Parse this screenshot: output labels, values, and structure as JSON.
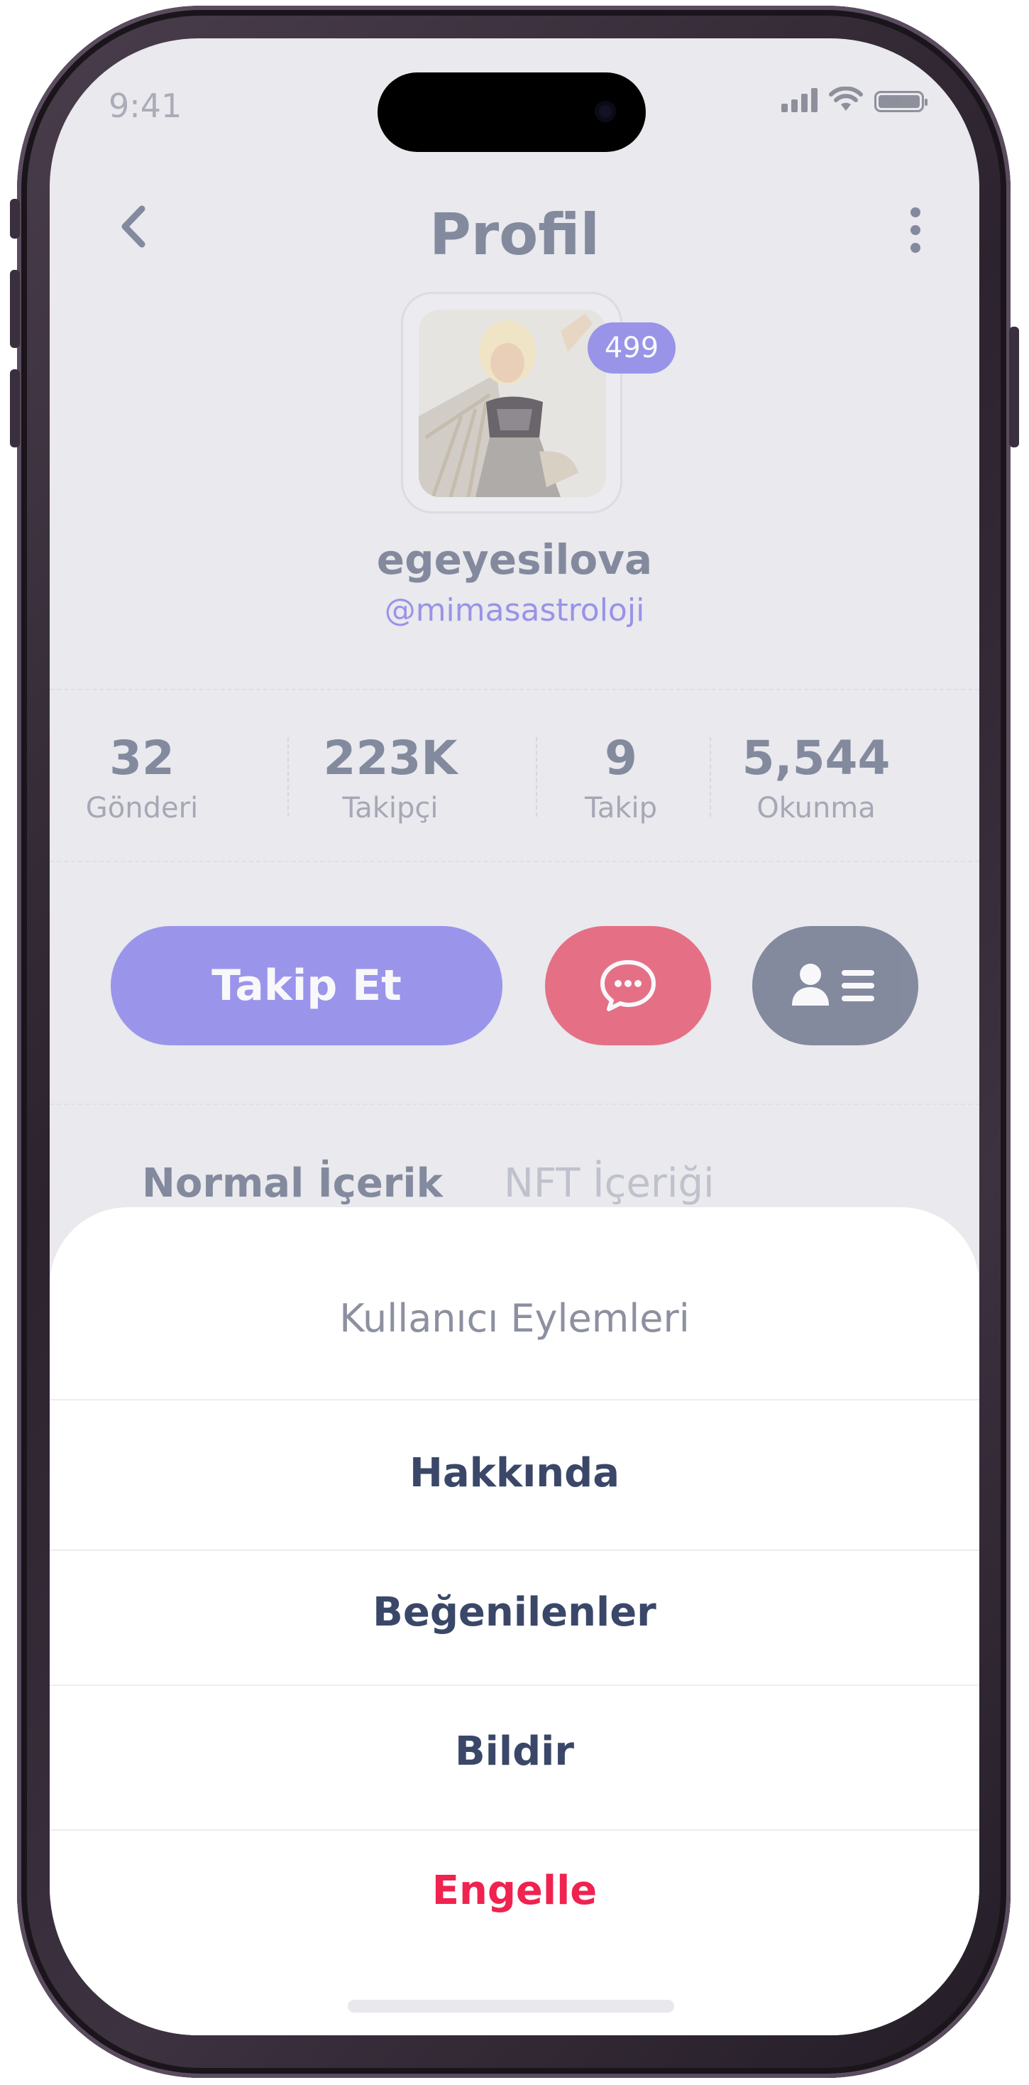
{
  "status_bar": {
    "time": "9:41"
  },
  "header": {
    "title": "Profil"
  },
  "profile": {
    "badge_count": "499",
    "display_name": "egeyesilova",
    "handle": "@mimasastroloji"
  },
  "stats": [
    {
      "value": "32",
      "label": "Gönderi"
    },
    {
      "value": "223K",
      "label": "Takipçi"
    },
    {
      "value": "9",
      "label": "Takip"
    },
    {
      "value": "5,544",
      "label": "Okunma"
    }
  ],
  "actions": {
    "follow_label": "Takip Et"
  },
  "tabs": [
    {
      "label": "Normal İçerik",
      "active": true
    },
    {
      "label": "NFT İçeriği",
      "active": false
    }
  ],
  "sheet": {
    "title": "Kullanıcı Eylemleri",
    "items": [
      {
        "label": "Hakkında"
      },
      {
        "label": "Beğenilenler"
      },
      {
        "label": "Bildir"
      },
      {
        "label": "Engelle",
        "destructive": true
      }
    ]
  },
  "colors": {
    "accent": "#7c74ea",
    "message": "#e4425f",
    "secondary": "#5d6680",
    "destructive": "#f0224f"
  }
}
